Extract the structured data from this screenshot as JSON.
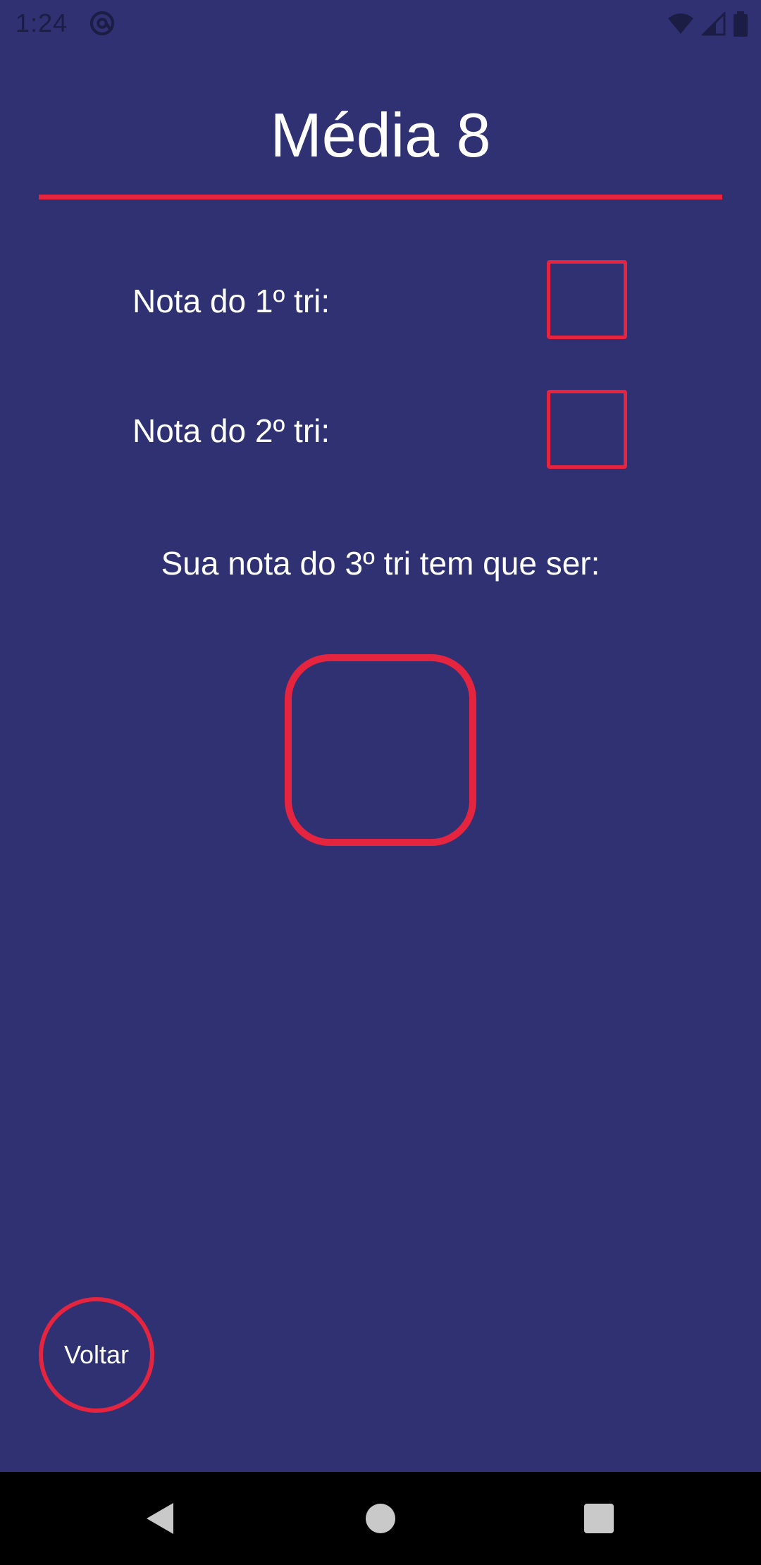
{
  "status_bar": {
    "time": "1:24",
    "app_icon": "at-sign-icon",
    "icons": [
      "wifi-icon",
      "signal-icon",
      "battery-icon"
    ]
  },
  "header": {
    "title": "Média 8"
  },
  "form": {
    "grade1_label": "Nota do 1º tri:",
    "grade1_value": "",
    "grade2_label": "Nota do 2º tri:",
    "grade2_value": "",
    "result_label": "Sua nota do 3º tri tem que ser:",
    "result_value": ""
  },
  "actions": {
    "back_label": "Voltar"
  },
  "nav_bar": {
    "icons": [
      "back-triangle-icon",
      "home-circle-icon",
      "recents-square-icon"
    ]
  },
  "colors": {
    "background": "#2f3172",
    "accent": "#e52440",
    "text": "#ffffff",
    "status_icons": "#1c1d45"
  }
}
